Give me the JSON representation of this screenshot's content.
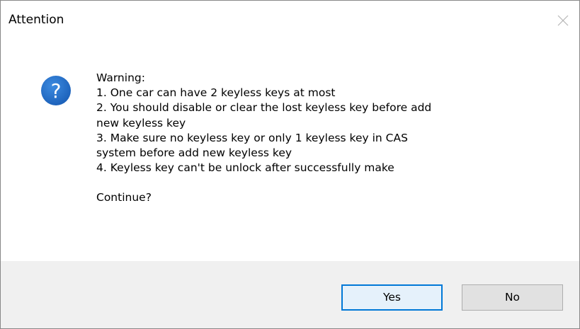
{
  "window": {
    "title": "Attention",
    "close_icon": "close-icon"
  },
  "message": {
    "icon": "question-icon",
    "icon_color": "#1f6cc8",
    "lines": [
      "Warning:",
      "1. One car can have 2 keyless keys at most",
      "2. You should disable or clear the lost keyless key before add",
      "new keyless key",
      "3. Make sure no keyless key or only 1 keyless key in CAS",
      "system before add new keyless key",
      "4. Keyless key can't be unlock after successfully make"
    ],
    "prompt": "Continue?"
  },
  "buttons": {
    "yes_label": "Yes",
    "no_label": "No",
    "default_accent": "#0078d7"
  }
}
